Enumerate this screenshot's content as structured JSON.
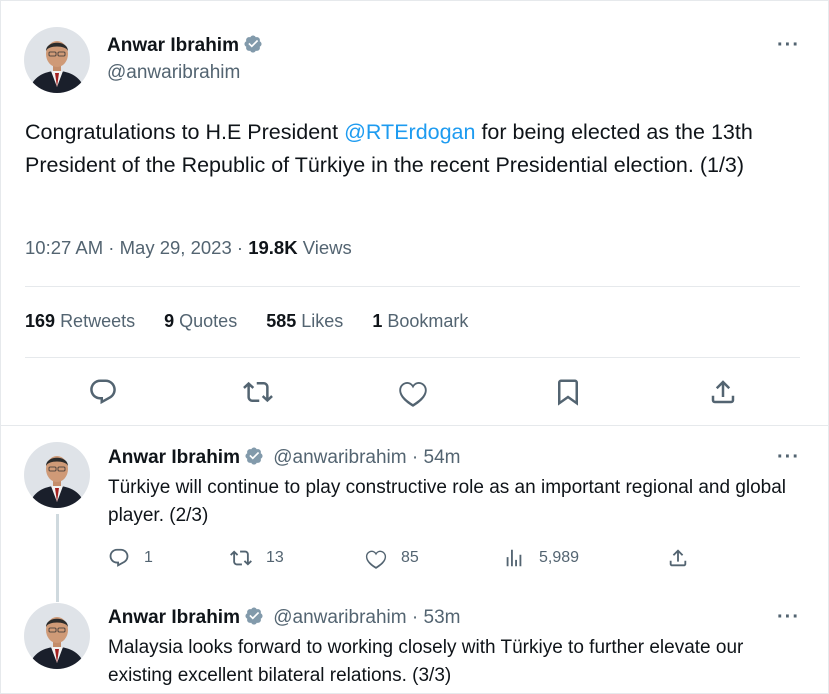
{
  "main_tweet": {
    "author_name": "Anwar Ibrahim",
    "author_handle": "@anwaribrahim",
    "more": "···",
    "text_before": "Congratulations to H.E President ",
    "mention": "@RTErdogan",
    "text_after": " for being elected as the 13th President of the Republic of Türkiye in the recent Presidential election. (1/3)",
    "time": "10:27 AM",
    "date": "May 29, 2023",
    "views_count": "19.8K",
    "views_label": "Views",
    "retweets_count": "169",
    "retweets_label": "Retweets",
    "quotes_count": "9",
    "quotes_label": "Quotes",
    "likes_count": "585",
    "likes_label": "Likes",
    "bookmarks_count": "1",
    "bookmarks_label": "Bookmark"
  },
  "replies": [
    {
      "author_name": "Anwar Ibrahim",
      "author_handle": "@anwaribrahim",
      "time_ago": "54m",
      "more": "···",
      "text": "Türkiye will continue to play constructive role as an important regional and global player. (2/3)",
      "reply_count": "1",
      "retweet_count": "13",
      "like_count": "85",
      "view_count": "5,989"
    },
    {
      "author_name": "Anwar Ibrahim",
      "author_handle": "@anwaribrahim",
      "time_ago": "53m",
      "more": "···",
      "text": "Malaysia looks forward to working closely with Türkiye to further elevate our existing excellent bilateral relations. (3/3)"
    }
  ],
  "colors": {
    "link": "#1d9bf0",
    "badge": "#829aab",
    "text_primary": "#0f1419",
    "text_secondary": "#536471",
    "divider": "#e6e9ec"
  },
  "icons": [
    "verified-badge-icon",
    "reply-icon",
    "retweet-icon",
    "like-icon",
    "bookmark-icon",
    "share-icon",
    "views-icon",
    "more-icon"
  ]
}
